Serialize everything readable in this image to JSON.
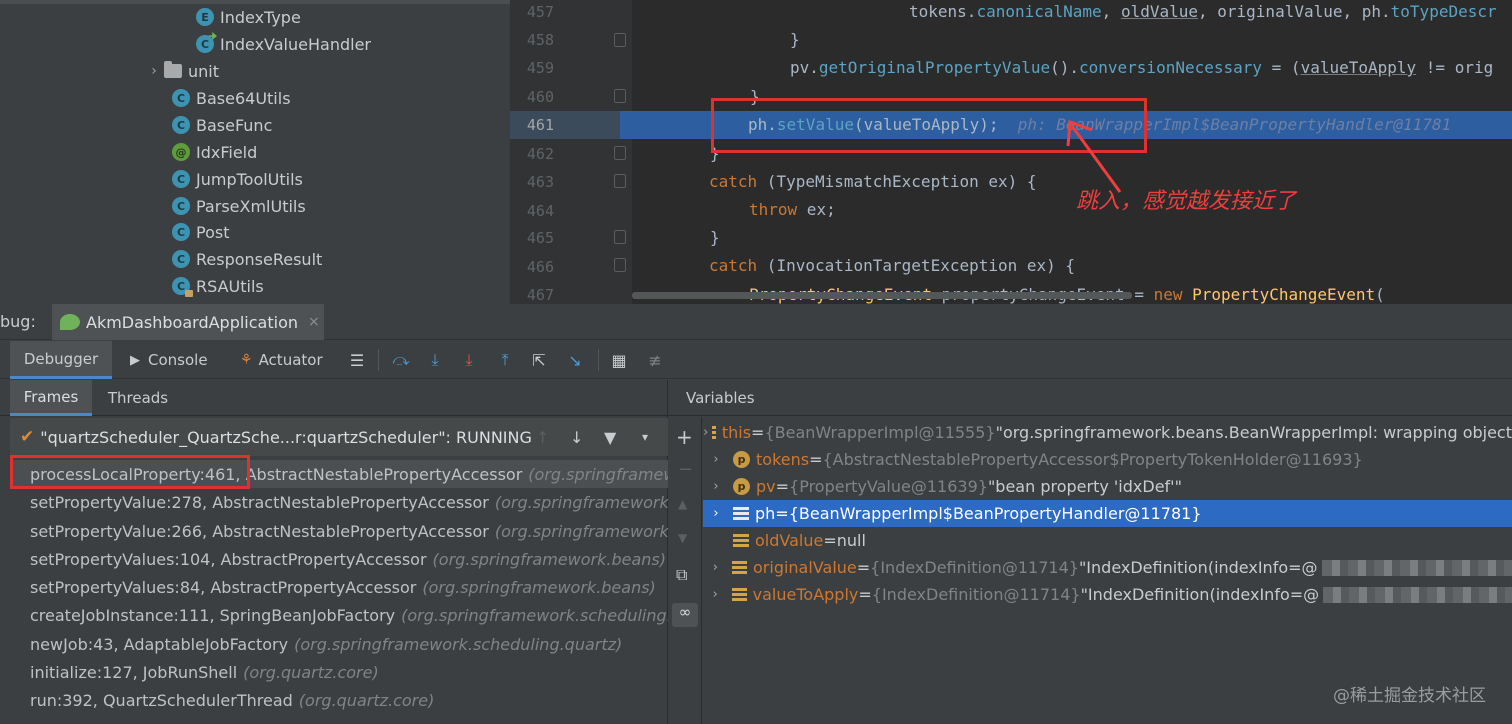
{
  "project_tree": {
    "items": [
      {
        "label": "IndexType",
        "icon": "enum-icon"
      },
      {
        "label": "IndexValueHandler",
        "icon": "class-icon"
      },
      {
        "label": "unit",
        "icon": "folder-icon"
      },
      {
        "label": "Base64Utils",
        "icon": "class-icon"
      },
      {
        "label": "BaseFunc",
        "icon": "class-icon"
      },
      {
        "label": "IdxField",
        "icon": "annotation-icon"
      },
      {
        "label": "JumpToolUtils",
        "icon": "class-icon"
      },
      {
        "label": "ParseXmlUtils",
        "icon": "class-icon"
      },
      {
        "label": "Post",
        "icon": "class-icon"
      },
      {
        "label": "ResponseResult",
        "icon": "class-icon"
      },
      {
        "label": "RSAUtils",
        "icon": "class-icon"
      }
    ]
  },
  "editor": {
    "line_numbers": [
      "457",
      "458",
      "459",
      "460",
      "461",
      "462",
      "463",
      "464",
      "465",
      "466",
      "467"
    ],
    "code": {
      "l457_a": "tokens.",
      "l457_b": "canonicalName",
      "l457_c": ", ",
      "l457_d": "oldValue",
      "l457_e": ", originalValue, ph.",
      "l457_f": "toTypeDescr",
      "l458": "}",
      "l459_a": "pv.",
      "l459_b": "getOriginalPropertyValue",
      "l459_c": "().",
      "l459_d": "conversionNecessary",
      "l459_e": " = (",
      "l459_f": "valueToApply",
      "l459_g": " != orig",
      "l460": "}",
      "l461_a": "ph.",
      "l461_b": "setValue",
      "l461_c": "(valueToApply);",
      "l461_inlay": "ph: BeanWrapperImpl$BeanPropertyHandler@11781",
      "l462": "}",
      "l463_kw": "catch",
      "l463_rest": " (TypeMismatchException ex) {",
      "l464_kw": "throw",
      "l464_rest": " ex;",
      "l465": "}",
      "l466_kw": "catch",
      "l466_rest": " (InvocationTargetException ex) {",
      "l467_a": "PropertyChangeEvent",
      "l467_b": " propertyChangeEvent = ",
      "l467_kw": "new",
      "l467_c": " ",
      "l467_d": "PropertyChangeEvent",
      "l467_e": "("
    },
    "annotation": "跳入，感觉越发接近了"
  },
  "debug": {
    "prefix": "bug:",
    "config_name": "AkmDashboardApplication",
    "tabs": {
      "debugger": "Debugger",
      "console": "Console",
      "actuator": "Actuator"
    },
    "frames_tab": "Frames",
    "threads_tab": "Threads",
    "thread": "\"quartzScheduler_QuartzSche...r:quartzScheduler\": RUNNING",
    "frames": [
      {
        "method": "processLocalProperty:461, AbstractNestablePropertyAccessor",
        "pkg": "(org.springframework.beans)"
      },
      {
        "method": "setPropertyValue:278, AbstractNestablePropertyAccessor",
        "pkg": "(org.springframework.beans)"
      },
      {
        "method": "setPropertyValue:266, AbstractNestablePropertyAccessor",
        "pkg": "(org.springframework.beans)"
      },
      {
        "method": "setPropertyValues:104, AbstractPropertyAccessor",
        "pkg": "(org.springframework.beans)"
      },
      {
        "method": "setPropertyValues:84, AbstractPropertyAccessor",
        "pkg": "(org.springframework.beans)"
      },
      {
        "method": "createJobInstance:111, SpringBeanJobFactory",
        "pkg": "(org.springframework.scheduling.quartz)"
      },
      {
        "method": "newJob:43, AdaptableJobFactory",
        "pkg": "(org.springframework.scheduling.quartz)"
      },
      {
        "method": "initialize:127, JobRunShell",
        "pkg": "(org.quartz.core)"
      },
      {
        "method": "run:392, QuartzSchedulerThread",
        "pkg": "(org.quartz.core)"
      }
    ],
    "variables_title": "Variables",
    "variables": [
      {
        "name": "this",
        "eq": " = ",
        "type": "{BeanWrapperImpl@11555}",
        "value": " \"org.springframework.beans.BeanWrapperImpl: wrapping object"
      },
      {
        "name": "tokens",
        "eq": " = ",
        "type": "{AbstractNestablePropertyAccessor$PropertyTokenHolder@11693}",
        "value": ""
      },
      {
        "name": "pv",
        "eq": " = ",
        "type": "{PropertyValue@11639}",
        "value": " \"bean property 'idxDef'\""
      },
      {
        "name": "ph",
        "eq": " = ",
        "type": "{BeanWrapperImpl$BeanPropertyHandler@11781}",
        "value": ""
      },
      {
        "name": "oldValue",
        "eq": " = ",
        "type": "",
        "value": "null"
      },
      {
        "name": "originalValue",
        "eq": " = ",
        "type": "{IndexDefinition@11714}",
        "value": " \"IndexDefinition(indexInfo=@"
      },
      {
        "name": "valueToApply",
        "eq": " = ",
        "type": "{IndexDefinition@11714}",
        "value": " \"IndexDefinition(indexInfo=@"
      }
    ],
    "watermark": "@稀土掘金技术社区"
  }
}
